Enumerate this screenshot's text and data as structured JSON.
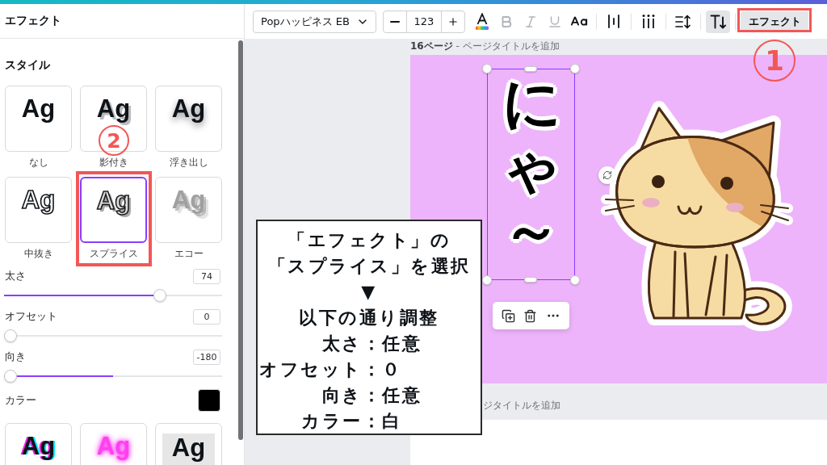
{
  "panel": {
    "title": "エフェクト",
    "section_title": "スタイル",
    "styles": [
      {
        "kind": "none",
        "preview": "Ag",
        "label": "なし",
        "selected": false
      },
      {
        "kind": "shadow",
        "preview": "Ag",
        "label": "影付き",
        "selected": false
      },
      {
        "kind": "lift",
        "preview": "Ag",
        "label": "浮き出し",
        "selected": false
      },
      {
        "kind": "hollow",
        "preview": "Ag",
        "label": "中抜き",
        "selected": false
      },
      {
        "kind": "splice",
        "preview": "Ag",
        "label": "スプライス",
        "selected": true,
        "annotation": {
          "step": "2"
        }
      },
      {
        "kind": "echo",
        "preview": "Ag",
        "label": "エコー",
        "selected": false
      }
    ],
    "settings": [
      {
        "kind": "slider",
        "label": "太さ",
        "value": "74",
        "level": 0.73
      },
      {
        "kind": "slider",
        "label": "オフセット",
        "value": "0",
        "level": 0
      },
      {
        "kind": "centered_slider",
        "label": "向き",
        "value": "-180",
        "level": 0
      }
    ],
    "color_setting": {
      "label": "カラー",
      "color": "#000000"
    },
    "more_styles": [
      {
        "kind": "glitch",
        "preview": "Ag"
      },
      {
        "kind": "neon",
        "preview": "Ag"
      },
      {
        "kind": "background",
        "preview": "Ag"
      }
    ]
  },
  "toolbar": {
    "font": "Popハッピネス EB",
    "font_size": "123",
    "format_buttons": [
      {
        "kind": "text_color",
        "disabled": false
      },
      {
        "kind": "bold",
        "disabled": true
      },
      {
        "kind": "italic",
        "disabled": true
      },
      {
        "kind": "underline",
        "disabled": true
      },
      {
        "kind": "case",
        "disabled": false
      }
    ],
    "tools": [
      {
        "kind": "align",
        "on": false
      },
      {
        "kind": "letter_spacing",
        "on": false
      },
      {
        "kind": "line_spacing",
        "on": false
      },
      {
        "kind": "vertical_text",
        "on": true
      }
    ],
    "effects_button": {
      "label": "エフェクト",
      "on": true,
      "annotation": {
        "step": "1"
      }
    }
  },
  "canvas": {
    "page_title": "**16ページ** - ページタイトルを追加",
    "text_element": {
      "text": "にゃ～",
      "selected": true
    },
    "next_page_title": "ジタイトルを追加"
  },
  "callout": {
    "lines": [
      "「エフェクト」の",
      "「スプライス」を選択",
      "▼",
      "以下の通り調整"
    ],
    "settings": [
      {
        "label": "太さ：",
        "value": "任意"
      },
      {
        "label": "オフセット：",
        "value": "０"
      },
      {
        "label": "向き：",
        "value": "任意"
      },
      {
        "label": "カラー：",
        "value": "白"
      }
    ]
  }
}
